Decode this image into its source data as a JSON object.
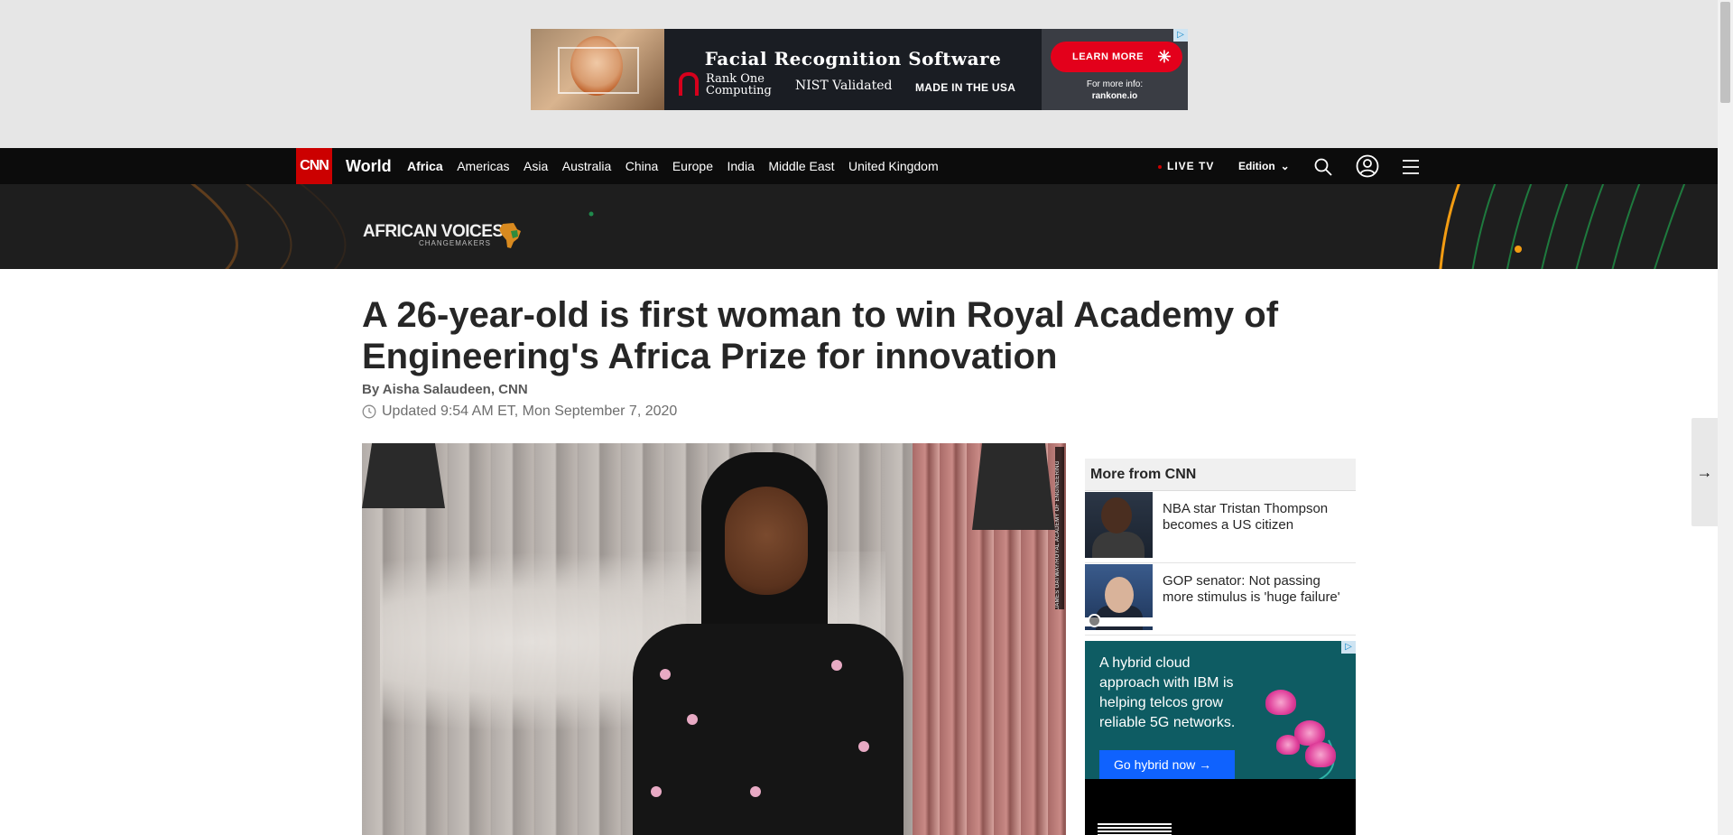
{
  "top_ad": {
    "headline": "Facial Recognition Software",
    "brand_line1": "Rank One",
    "brand_line2": "Computing",
    "nist": "NIST Validated",
    "made": "MADE IN THE USA",
    "cta": "LEARN MORE",
    "info_line": "For more info:",
    "info_url": "rankone.io"
  },
  "nav": {
    "logo": "CNN",
    "section": "World",
    "links": [
      "Africa",
      "Americas",
      "Asia",
      "Australia",
      "China",
      "Europe",
      "India",
      "Middle East",
      "United Kingdom"
    ],
    "active_link": "Africa",
    "live_tv": "LIVE TV",
    "edition": "Edition",
    "icons": [
      "search-icon",
      "user-icon",
      "menu-icon"
    ]
  },
  "banner": {
    "title": "AFRICAN VOICES",
    "subtitle": "CHANGEMAKERS"
  },
  "article": {
    "headline": "A 26-year-old is first woman to win Royal Academy of Engineering's Africa Prize for innovation",
    "byline": "By Aisha Salaudeen, CNN",
    "timestamp": "Updated 9:54 AM ET, Mon September 7, 2020",
    "photo_credit": "JAMES OATWAY/ROYAL ACADEMY OF ENGINEERING"
  },
  "rail": {
    "heading": "More from CNN",
    "items": [
      {
        "title": "NBA star Tristan Thompson becomes a US citizen"
      },
      {
        "title": "GOP senator: Not passing more stimulus is 'huge failure'"
      }
    ]
  },
  "ibm_ad": {
    "text": "A hybrid cloud approach with IBM is helping telcos grow reliable 5G networks.",
    "cta": "Go hybrid now  →"
  },
  "colors": {
    "cnn_red": "#cc0000",
    "nav_bg": "#0c0c0c",
    "ibm_blue": "#0f62fe"
  }
}
